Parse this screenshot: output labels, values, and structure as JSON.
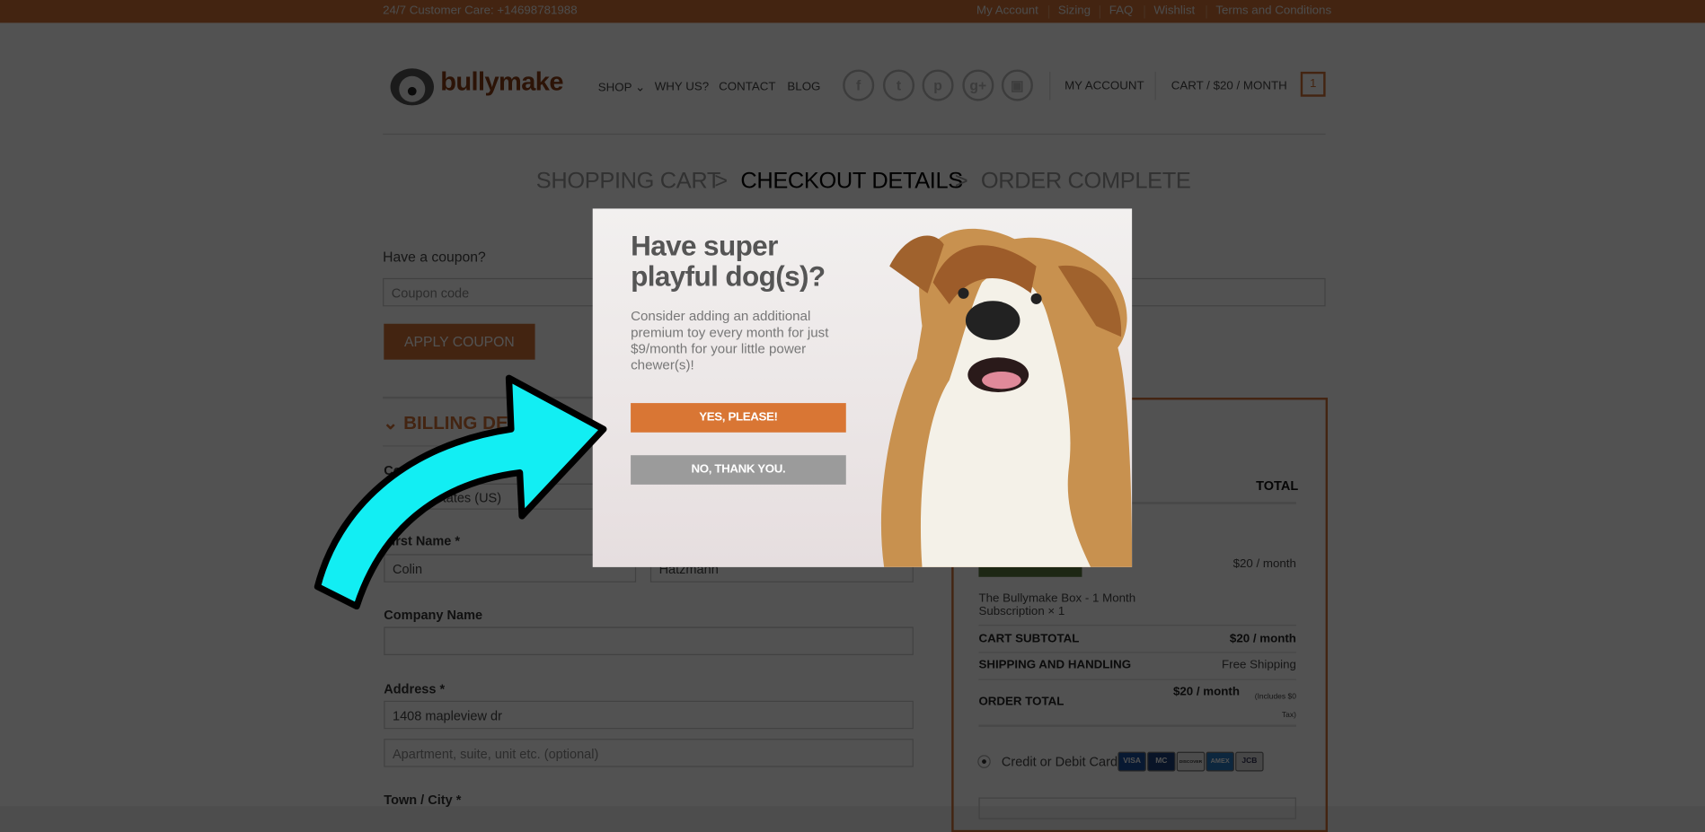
{
  "topbar": {
    "care": "24/7 Customer Care: +14698781988",
    "links": [
      "My Account",
      "Sizing",
      "FAQ",
      "Wishlist",
      "Terms and Conditions"
    ]
  },
  "header": {
    "logo": "bullymake",
    "nav": [
      "SHOP",
      "WHY US?",
      "CONTACT",
      "BLOG"
    ],
    "social": [
      "facebook-icon",
      "twitter-icon",
      "pinterest-icon",
      "google-plus-icon",
      "instagram-icon"
    ],
    "my_account": "MY ACCOUNT",
    "cart": "CART / $20 / MONTH",
    "cart_count": "1"
  },
  "breadcrumb": {
    "steps": [
      "SHOPPING CART",
      "CHECKOUT DETAILS",
      "ORDER COMPLETE"
    ],
    "sep": ">"
  },
  "coupon": {
    "prompt": "Have a coupon?",
    "placeholder": "Coupon code",
    "button": "APPLY COUPON"
  },
  "billing": {
    "title": "BILLING DETAILS",
    "country_label": "Country *",
    "country": "United States (US)",
    "first_name_label": "First Name *",
    "first_name": "Colin",
    "last_name": "Hatzmann",
    "company_label": "Company Name",
    "company": "",
    "address_label": "Address *",
    "address": "1408 mapleview dr",
    "address2_placeholder": "Apartment, suite, unit etc. (optional)",
    "city_label": "Town / City *"
  },
  "order": {
    "total_header": "TOTAL",
    "item_price": "$20 / month",
    "item_name": "The Bullymake Box - 1 Month Subscription × 1",
    "subtotal_label": "CART SUBTOTAL",
    "subtotal": "$20 / month",
    "shipping_label": "SHIPPING AND HANDLING",
    "shipping": "Free Shipping",
    "total_label": "ORDER TOTAL",
    "total": "$20 / month",
    "tax_note": "(Includes $0 Tax)",
    "payment": "Credit or Debit Card",
    "cards": [
      "VISA",
      "MC",
      "DISCOVER",
      "AMEX",
      "JCB"
    ]
  },
  "modal": {
    "title": "Have super playful dog(s)?",
    "body": "Consider adding an additional premium toy every month for just $9/month for your little power chewer(s)!",
    "yes": "YES, PLEASE!",
    "no": "NO, THANK YOU.",
    "yes_color": "#d97634",
    "no_color": "#9b9b9b"
  },
  "annotation": {
    "arrow_color": "#12eef3"
  }
}
